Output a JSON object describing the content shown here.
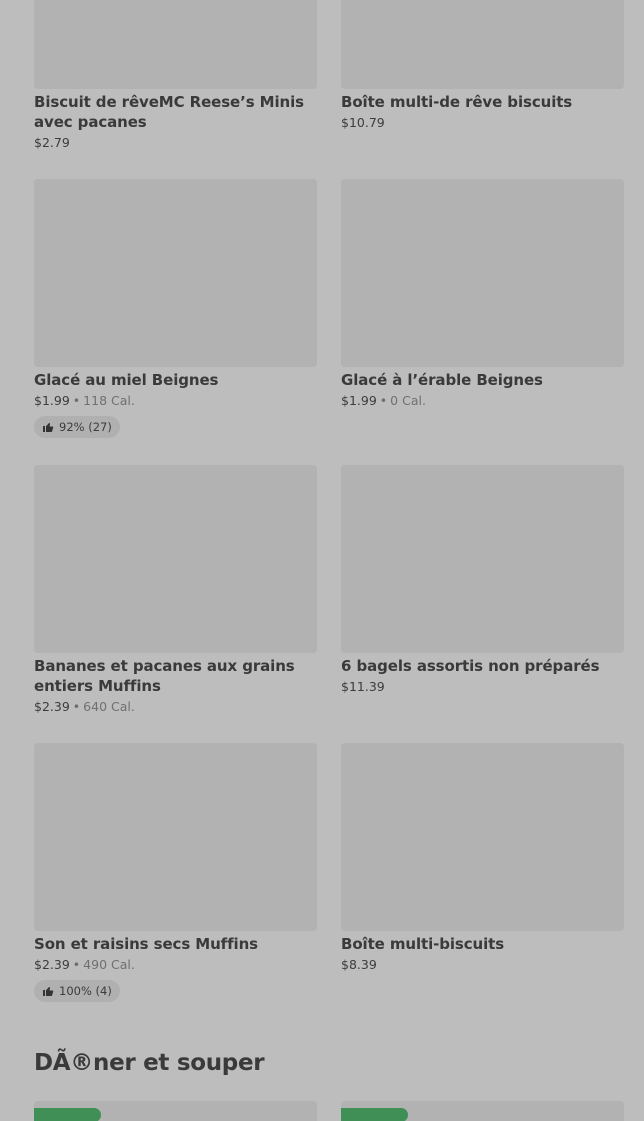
{
  "items": [
    {
      "name": "Biscuit de rêveMC Reese’s Minis avec pacanes",
      "price": "$2.79",
      "calories": "",
      "rating": ""
    },
    {
      "name": "Boîte multi-de rêve biscuits",
      "price": "$10.79",
      "calories": "",
      "rating": ""
    },
    {
      "name": "Glacé au miel Beignes",
      "price": "$1.99",
      "calories": "118 Cal.",
      "rating": "92% (27)"
    },
    {
      "name": "Glacé à l’érable Beignes",
      "price": "$1.99",
      "calories": "0 Cal.",
      "rating": ""
    },
    {
      "name": "Bananes et pacanes aux grains entiers Muffins",
      "price": "$2.39",
      "calories": "640 Cal.",
      "rating": ""
    },
    {
      "name": "6 bagels assortis non préparés",
      "price": "$11.39",
      "calories": "",
      "rating": ""
    },
    {
      "name": "Son et raisins secs Muffins",
      "price": "$2.39",
      "calories": "490 Cal.",
      "rating": "100% (4)"
    },
    {
      "name": "Boîte multi-biscuits",
      "price": "$8.39",
      "calories": "",
      "rating": ""
    }
  ],
  "section": {
    "title": "DÃ®ner et souper"
  },
  "separator": "•",
  "icons": {
    "rating": "thumbs-up-icon"
  },
  "colors": {
    "badge": "#3f8f57"
  }
}
